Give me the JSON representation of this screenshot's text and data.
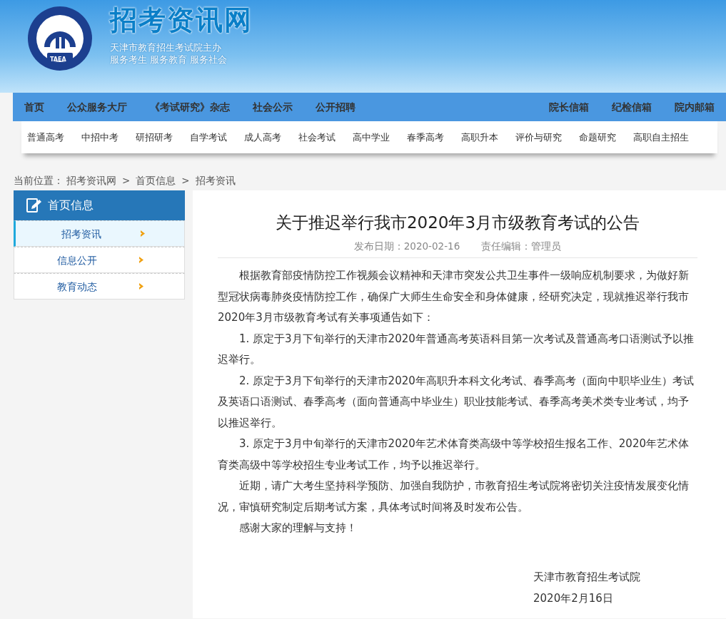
{
  "header": {
    "logo_text": "TAEA",
    "site_title": "招考资讯网",
    "tagline_lines": [
      "天津市教育招生考试院主办",
      "服务考生 服务教育 服务社会"
    ]
  },
  "nav": {
    "left": [
      "首页",
      "公众服务大厅",
      "《考试研究》杂志",
      "社会公示",
      "公开招聘"
    ],
    "right": [
      "院长信箱",
      "纪检信箱",
      "院内邮箱"
    ]
  },
  "subnav": [
    "普通高考",
    "中招中考",
    "研招研考",
    "自学考试",
    "成人高考",
    "社会考试",
    "高中学业",
    "春季高考",
    "高职升本",
    "评价与研究",
    "命题研究",
    "高职自主招生"
  ],
  "breadcrumb": {
    "label": "当前位置：",
    "separator": ">",
    "items": [
      "招考资讯网",
      "首页信息",
      "招考资讯"
    ]
  },
  "sidebar": {
    "title": "首页信息",
    "items": [
      {
        "label": "招考资讯",
        "selected": true
      },
      {
        "label": "信息公开",
        "selected": false
      },
      {
        "label": "教育动态",
        "selected": false
      }
    ]
  },
  "article": {
    "title": "关于推迟举行我市2020年3月市级教育考试的公告",
    "meta": [
      "发布日期：2020-02-16",
      "责任编辑：管理员"
    ],
    "paragraphs": [
      "根据教育部疫情防控工作视频会议精神和天津市突发公共卫生事件一级响应机制要求，为做好新型冠状病毒肺炎疫情防控工作，确保广大师生生命安全和身体健康，经研究决定，现就推迟举行我市2020年3月市级教育考试有关事项通告如下：",
      "1. 原定于3月下旬举行的天津市2020年普通高考英语科目第一次考试及普通高考口语测试予以推迟举行。",
      "2. 原定于3月下旬举行的天津市2020年高职升本科文化考试、春季高考（面向中职毕业生）考试及英语口语测试、春季高考（面向普通高中毕业生）职业技能考试、春季高考美术类专业考试，均予以推迟举行。",
      "3. 原定于3月中旬举行的天津市2020年艺术体育类高级中等学校招生报名工作、2020年艺术体育类高级中等学校招生专业考试工作，均予以推迟举行。",
      "近期，请广大考生坚持科学预防、加强自我防护，市教育招生考试院将密切关注疫情发展变化情况，审慎研究制定后期考试方案，具体考试时间将及时发布公告。",
      "感谢大家的理解与支持！"
    ],
    "signature": [
      "天津市教育招生考试院",
      "2020年2月16日"
    ]
  }
}
